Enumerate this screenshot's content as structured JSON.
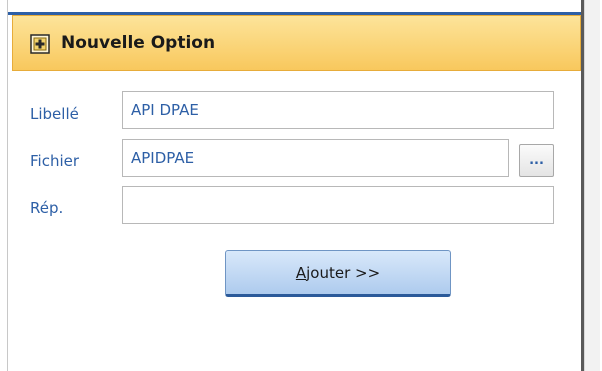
{
  "panel": {
    "title": "Nouvelle Option",
    "icon": "add-option-icon"
  },
  "form": {
    "libelle_label": "Libellé",
    "libelle_value": "API DPAE",
    "fichier_label": "Fichier",
    "fichier_value": "APIDPAE",
    "browse_label": "...",
    "rep_label": "Rép.",
    "rep_value": ""
  },
  "actions": {
    "add_mnemonic": "A",
    "add_label_rest": "jouter >>"
  },
  "colors": {
    "accent": "#2d5fa6",
    "header_bg": "#f8c85d",
    "button_bg": "#aecbee"
  }
}
